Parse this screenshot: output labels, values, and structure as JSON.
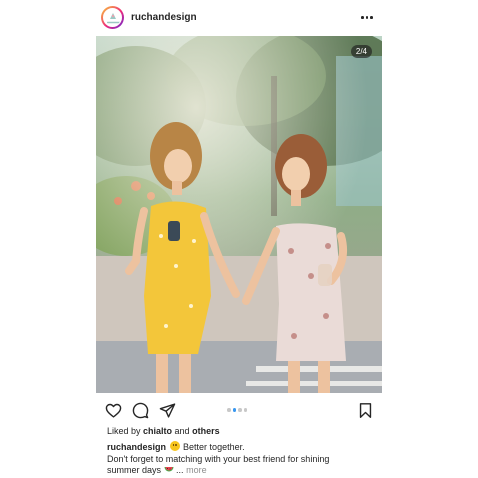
{
  "post": {
    "username": "ruchandesign",
    "avatar_text": "ruchan",
    "slide_counter": "2/4",
    "carousel": {
      "total": 4,
      "active_index": 1
    },
    "likes": {
      "prefix": "Liked by ",
      "user": "chialto",
      "middle": " and ",
      "suffix": "others"
    },
    "caption": {
      "author": "ruchandesign",
      "line1": "Better together.",
      "line2": "Don't forget to matching with your best friend for shining",
      "line3": "summer days",
      "ellipsis": "...",
      "more": "more"
    }
  },
  "icons": {
    "more": "more-horizontal-icon",
    "like": "heart-icon",
    "comment": "comment-icon",
    "share": "paper-plane-icon",
    "save": "bookmark-icon"
  },
  "colors": {
    "active_dot": "#3897f0",
    "text": "#262626",
    "muted": "#8e8e8e"
  }
}
